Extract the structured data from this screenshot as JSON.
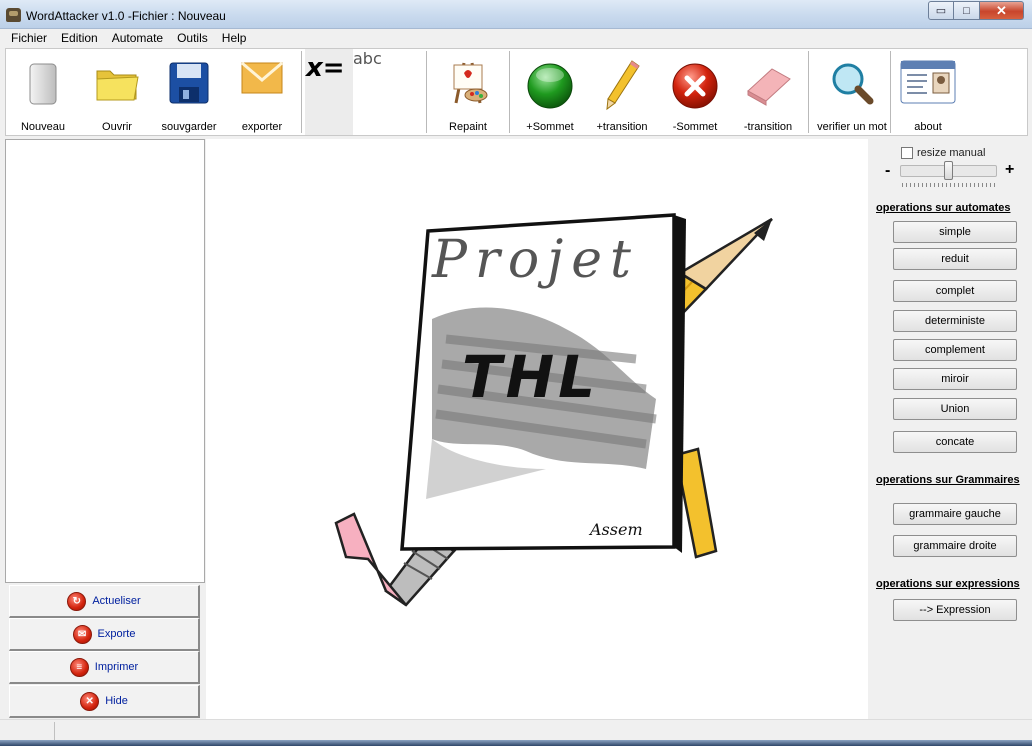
{
  "window": {
    "title": "WordAttacker v1.0 -Fichier : Nouveau",
    "min_glyph": "▭",
    "max_glyph": "□",
    "close_glyph": "✕"
  },
  "menu": [
    "Fichier",
    "Edition",
    "Automate",
    "Outils",
    "Help"
  ],
  "toolbar": {
    "nouveau": "Nouveau",
    "ouvrir": "Ouvrir",
    "sauvegarder": "souvgarder",
    "exporter": "exporter",
    "formula_x": "x=",
    "formula_abc": "abc",
    "repaint": "Repaint",
    "add_state": "+Sommet",
    "add_transition": "+transition",
    "remove_state": "-Sommet",
    "remove_transition": "-transition",
    "verify_word": "verifier un mot",
    "about": "about"
  },
  "left_actions": {
    "actualiser": "Actueliser",
    "exporte": "Exporte",
    "imprimer": "Imprimer",
    "hide": "Hide"
  },
  "splash": {
    "title": "Projet",
    "subtitle": "THL",
    "signature": "Assem"
  },
  "right_panel": {
    "resize_label": "resize manual",
    "resize_checked": false,
    "minus": "-",
    "plus": "+",
    "automata_title": "operations sur automates",
    "automata_ops": [
      "simple",
      "reduit",
      "complet",
      "deterministe",
      "complement",
      "miroir",
      "Union",
      "concate"
    ],
    "grammar_title": "operations sur Grammaires",
    "grammar_ops": [
      "grammaire gauche",
      "grammaire droite"
    ],
    "expr_title": "operations sur expressions",
    "expr_ops": [
      "--> Expression"
    ]
  },
  "colors": {
    "titlebar": "#c9daee",
    "link_blue": "#00209f",
    "danger_red": "#d2230d",
    "success_green": "#1f9a1f"
  }
}
